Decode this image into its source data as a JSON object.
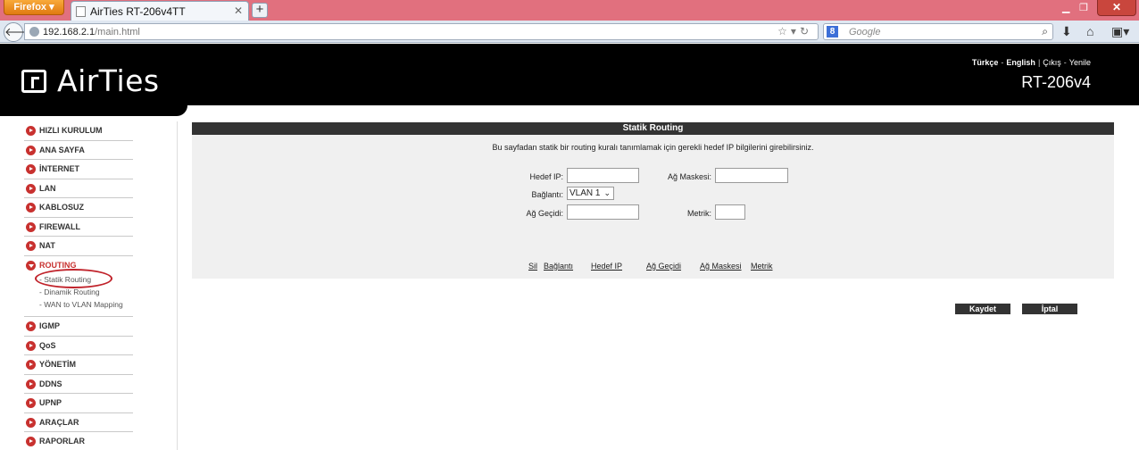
{
  "browser": {
    "app_button": "Firefox",
    "tab_title": "AirTies RT-206v4TT",
    "new_tab": "+",
    "url_host": "192.168.2.1",
    "url_path": "/main.html",
    "search_placeholder": "Google",
    "search_engine_badge": "8"
  },
  "header": {
    "brand": "AirTies",
    "lang_tr": "Türkçe",
    "lang_en": "English",
    "logout": "Çıkış",
    "refresh": "Yenile",
    "model": "RT-206v4"
  },
  "sidebar": {
    "items": [
      {
        "label": "HIZLI KURULUM"
      },
      {
        "label": "ANA SAYFA"
      },
      {
        "label": "İNTERNET"
      },
      {
        "label": "LAN"
      },
      {
        "label": "KABLOSUZ"
      },
      {
        "label": "FIREWALL"
      },
      {
        "label": "NAT"
      },
      {
        "label": "ROUTING"
      }
    ],
    "routing_sub": [
      "- Statik Routing",
      "- Dinamik Routing",
      "- WAN to VLAN Mapping"
    ],
    "items_after": [
      {
        "label": "IGMP"
      },
      {
        "label": "QoS"
      },
      {
        "label": "YÖNETİM"
      },
      {
        "label": "DDNS"
      },
      {
        "label": "UPNP"
      },
      {
        "label": "ARAÇLAR"
      },
      {
        "label": "RAPORLAR"
      }
    ]
  },
  "main": {
    "title": "Statik Routing",
    "description": "Bu sayfadan statik bir routing kuralı tanımlamak için gerekli hedef IP bilgilerini girebilirsiniz.",
    "labels": {
      "dest_ip": "Hedef IP:",
      "mask": "Ağ Maskesi:",
      "conn": "Bağlantı:",
      "gateway": "Ağ Geçidi:",
      "metric": "Metrik:"
    },
    "values": {
      "dest_ip": "",
      "mask": "",
      "conn": "VLAN 1",
      "gateway": "",
      "metric": ""
    },
    "columns": [
      "Sil",
      "Bağlantı",
      "Hedef IP",
      "Ağ Geçidi",
      "Ağ Maskesi",
      "Metrik"
    ],
    "save": "Kaydet",
    "cancel": "İptal"
  }
}
